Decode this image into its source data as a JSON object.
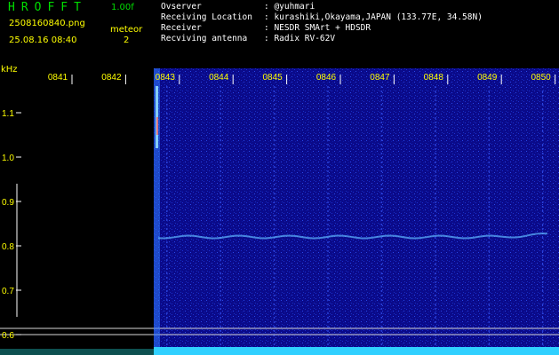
{
  "header": {
    "app_title": "HROFFT",
    "version": "1.00f",
    "file_name": "2508160840.png",
    "timestamp": "25.08.16 08:40",
    "detection_label": "meteor",
    "detection_count": "2"
  },
  "station_info": [
    {
      "label": "Ovserver",
      "value": ": @yuhmari"
    },
    {
      "label": "Receiving Location",
      "value": ": kurashiki,Okayama,JAPAN (133.77E, 34.58N)"
    },
    {
      "label": "Receiver",
      "value": ": NESDR SMArt + HDSDR"
    },
    {
      "label": "Recviving antenna",
      "value": ": Radix RV-62V"
    }
  ],
  "axis": {
    "y_unit": "kHz",
    "y_ticks": [
      "1.1",
      "1.0",
      "0.9",
      "0.8",
      "0.7",
      "0.6"
    ],
    "x_ticks": [
      "0841",
      "0842",
      "0843",
      "0844",
      "0845",
      "0846",
      "0847",
      "0848",
      "0849",
      "0850"
    ]
  },
  "colors": {
    "title": "#00dd00",
    "label": "#ffff00",
    "text": "#ffffff",
    "background": "#0a0a8a",
    "guide_line": "#d8d8d8",
    "signal": "#30d0ff"
  }
}
